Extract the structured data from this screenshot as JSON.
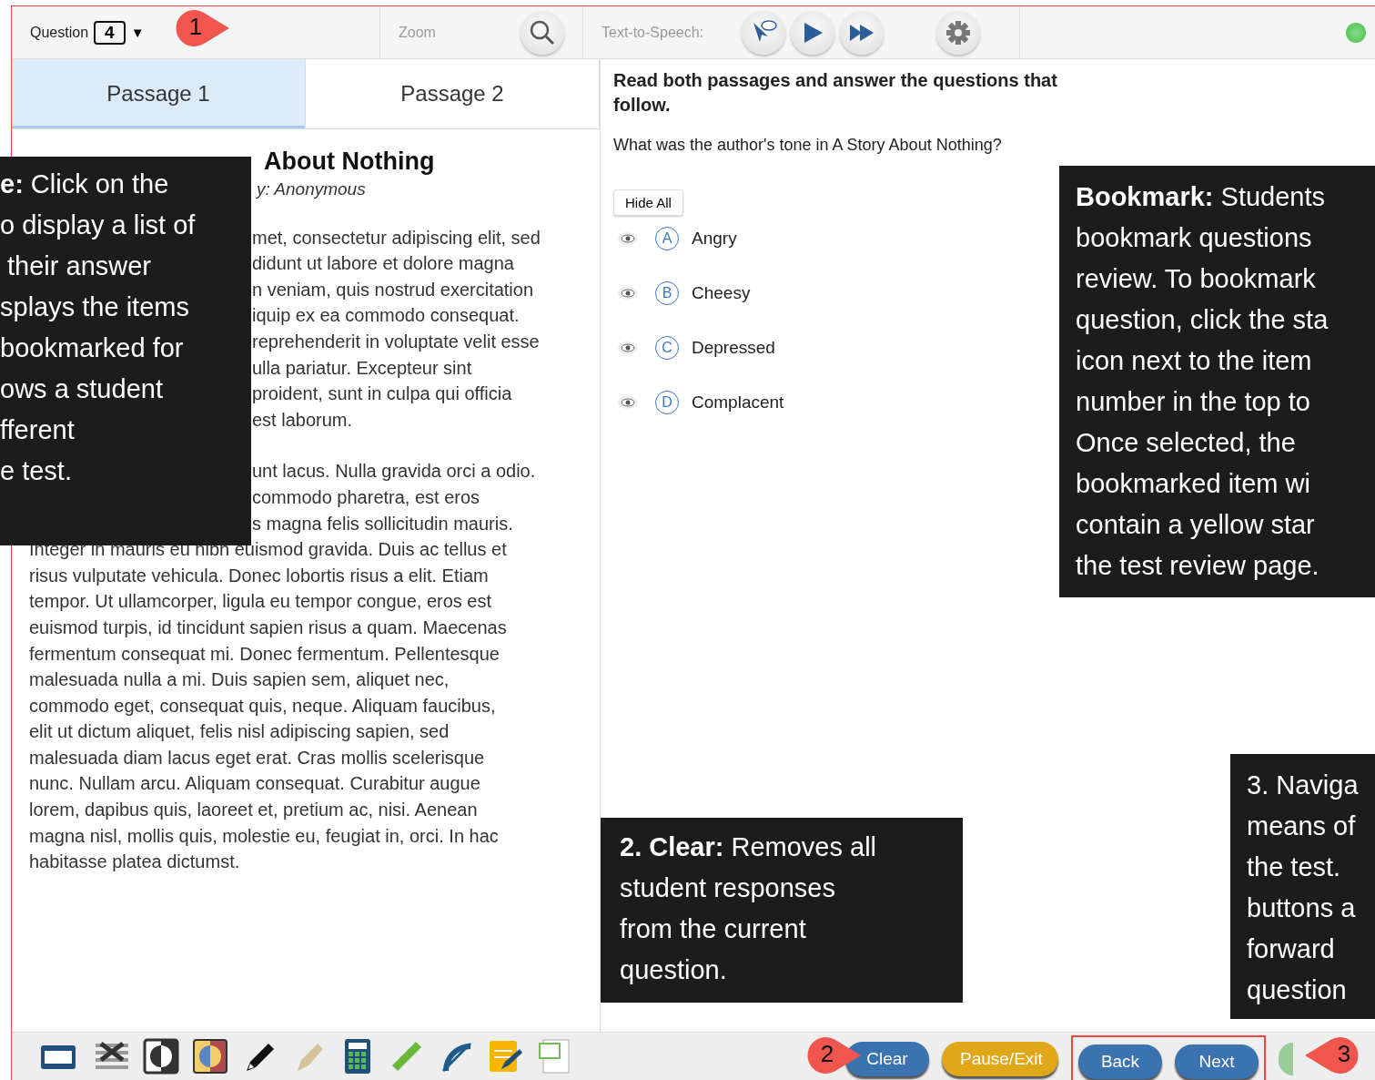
{
  "top_bar": {
    "question_label": "Question",
    "question_number": "4",
    "dropdown_glyph": "▼",
    "zoom_label": "Zoom",
    "tts_label": "Text-to-Speech:"
  },
  "passage_tabs": [
    {
      "label": "Passage 1",
      "selected": true
    },
    {
      "label": "Passage 2",
      "selected": false
    }
  ],
  "passage": {
    "title": "About Nothing",
    "byline": "y: Anonymous",
    "partial_lines": [
      "met, consectetur adipiscing elit, sed",
      "didunt ut labore et dolore magna",
      "n veniam, quis nostrud exercitation",
      "iquip ex ea commodo consequat.",
      "reprehenderit in voluptate velit esse",
      "ulla pariatur. Excepteur sint",
      "proident, sunt in culpa qui officia",
      "est laborum."
    ],
    "partial_lines_2": [
      "unt lacus. Nulla gravida orci a odio.",
      "commodo pharetra, est eros",
      "s magna felis sollicitudin mauris."
    ],
    "lines": [
      "Integer in mauris eu nibh euismod gravida. Duis ac tellus et",
      "risus vulputate vehicula. Donec lobortis risus a elit. Etiam",
      "tempor. Ut ullamcorper, ligula eu tempor congue, eros est",
      "euismod turpis, id tincidunt sapien risus a quam. Maecenas",
      "fermentum consequat mi. Donec fermentum. Pellentesque",
      "malesuada nulla a mi. Duis sapien sem, aliquet nec,",
      "commodo eget, consequat quis, neque. Aliquam faucibus,",
      "elit ut dictum aliquet, felis nisl adipiscing sapien, sed",
      "malesuada diam lacus eget erat. Cras mollis scelerisque",
      "nunc. Nullam arcu. Aliquam consequat. Curabitur augue",
      "lorem, dapibus quis, laoreet et, pretium ac, nisi. Aenean",
      "magna nisl, mollis quis, molestie eu, feugiat in, orci. In hac",
      "habitasse platea dictumst."
    ]
  },
  "question": {
    "instruction": "Read both passages and answer the questions that follow.",
    "prompt": "What was the author's tone in A Story About Nothing?",
    "hide_all": "Hide All",
    "options": [
      {
        "letter": "A",
        "text": "Angry",
        "selected": false
      },
      {
        "letter": "B",
        "text": "Cheesy",
        "selected": false
      },
      {
        "letter": "C",
        "text": "Depressed",
        "selected": false
      },
      {
        "letter": "D",
        "text": "Complacent",
        "selected": false
      }
    ]
  },
  "bottom_buttons": [
    {
      "label": "Clear",
      "kind": "blue"
    },
    {
      "label": "Pause/Exit",
      "kind": "gold"
    },
    {
      "label": "Back",
      "kind": "blue"
    },
    {
      "label": "Next",
      "kind": "blue"
    }
  ],
  "callouts": [
    {
      "kind": "left",
      "lines": [
        "**e:** Click on the",
        "o display a list of",
        " their answer",
        "splays the items",
        "bookmarked for",
        "ows a student",
        "fferent",
        "e test."
      ]
    },
    {
      "kind": "bookmark",
      "lines": [
        "**Bookmark:** Students",
        "bookmark questions",
        "review. To bookmark",
        "question, click the sta",
        "icon next to the item",
        "number in the top to",
        "Once selected, the",
        "bookmarked item wi",
        "contain a yellow star",
        "the test review page."
      ]
    },
    {
      "kind": "clear",
      "lines": [
        "**2. Clear:** Removes all",
        "student responses",
        "from the current",
        "question."
      ]
    },
    {
      "kind": "navigate",
      "lines": [
        "3. Naviga",
        "means of",
        "the test.",
        "buttons a",
        "forward",
        "question"
      ]
    }
  ],
  "markers": [
    {
      "kind": "question",
      "number": "1"
    },
    {
      "kind": "clear",
      "number": "2"
    },
    {
      "kind": "navigate",
      "number": "3"
    }
  ]
}
